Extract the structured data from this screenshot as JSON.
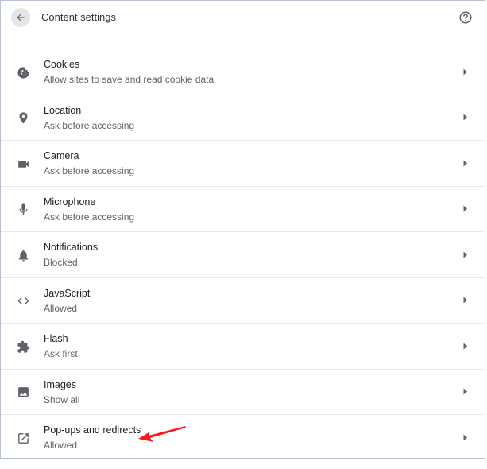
{
  "header": {
    "title": "Content settings",
    "back_icon": "arrow-back-icon",
    "help_icon": "help-circle-icon"
  },
  "settings": [
    {
      "key": "cookies",
      "label": "Cookies",
      "sub": "Allow sites to save and read cookie data",
      "icon": "cookie-icon"
    },
    {
      "key": "location",
      "label": "Location",
      "sub": "Ask before accessing",
      "icon": "location-pin-icon"
    },
    {
      "key": "camera",
      "label": "Camera",
      "sub": "Ask before accessing",
      "icon": "camera-icon"
    },
    {
      "key": "microphone",
      "label": "Microphone",
      "sub": "Ask before accessing",
      "icon": "microphone-icon"
    },
    {
      "key": "notifications",
      "label": "Notifications",
      "sub": "Blocked",
      "icon": "bell-icon"
    },
    {
      "key": "javascript",
      "label": "JavaScript",
      "sub": "Allowed",
      "icon": "code-brackets-icon"
    },
    {
      "key": "flash",
      "label": "Flash",
      "sub": "Ask first",
      "icon": "puzzle-piece-icon"
    },
    {
      "key": "images",
      "label": "Images",
      "sub": "Show all",
      "icon": "image-icon"
    },
    {
      "key": "popups",
      "label": "Pop-ups and redirects",
      "sub": "Allowed",
      "icon": "open-in-new-icon"
    }
  ],
  "colors": {
    "icon": "#5f6368",
    "annotation_arrow": "#ff1a1a"
  }
}
